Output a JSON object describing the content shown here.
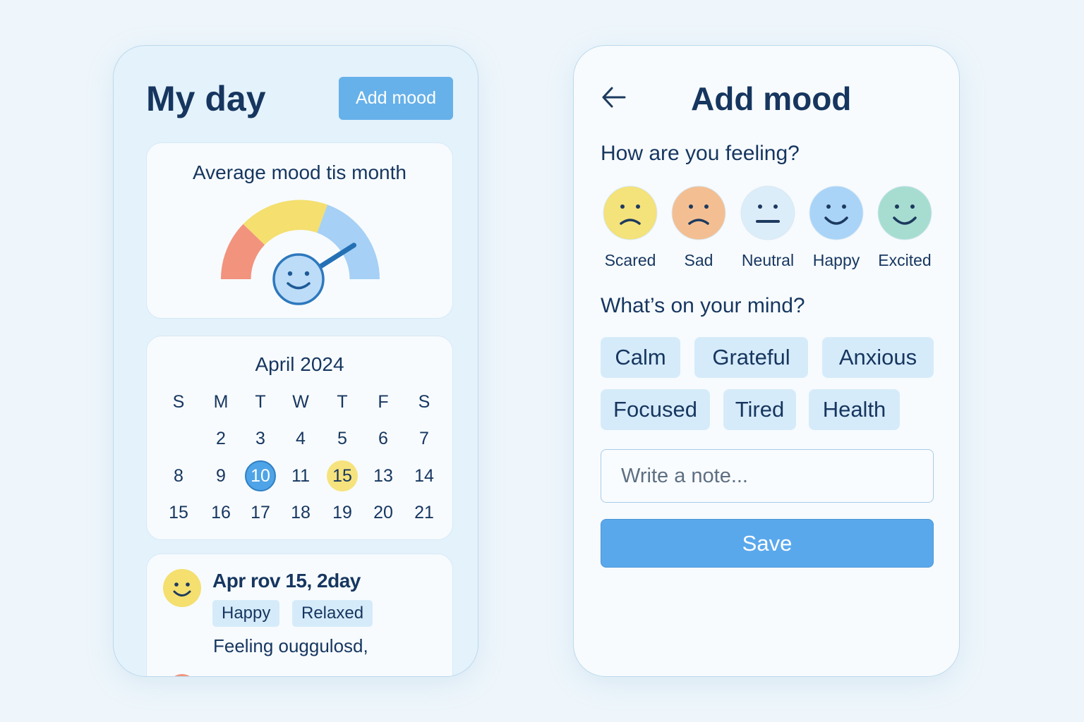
{
  "my_day": {
    "title": "My day",
    "add_mood_label": "Add mood",
    "average": {
      "title": "Average mood tis month",
      "gauge_level": 0.82,
      "gauge_colors": [
        "#f2937e",
        "#f4df6f",
        "#a6d0f5"
      ]
    },
    "calendar": {
      "month_label": "April 2024",
      "weekday_headers": [
        "S",
        "M",
        "T",
        "W",
        "T",
        "F",
        "S"
      ],
      "rows": [
        [
          "",
          "2",
          "3",
          "4",
          "5",
          "6",
          "7"
        ],
        [
          "8",
          "9",
          "10",
          "11",
          "15",
          "13",
          "14"
        ],
        [
          "15",
          "16",
          "17",
          "18",
          "19",
          "20",
          "21"
        ]
      ],
      "highlights": {
        "10": "blue",
        "15": "yellow"
      }
    },
    "entry": {
      "face_icon": "happy-face-icon",
      "date": "Apr rov 15, 2day",
      "tags": [
        "Happy",
        "Relaxed"
      ],
      "note": "Feeling ouggulosd,"
    }
  },
  "add_mood": {
    "back_icon": "arrow-left-icon",
    "title": "Add mood",
    "feeling_question": "How are you feeling?",
    "moods": [
      {
        "label": "Scared",
        "color": "#f4e27a",
        "mouth": "frown"
      },
      {
        "label": "Sad",
        "color": "#f3bf92",
        "mouth": "frown"
      },
      {
        "label": "Neutral",
        "color": "#dcedfa",
        "mouth": "flat"
      },
      {
        "label": "Happy",
        "color": "#a9d4f7",
        "mouth": "smile"
      },
      {
        "label": "Excited",
        "color": "#a7ddd1",
        "mouth": "smile"
      }
    ],
    "mind_question": "What’s on your mind?",
    "chips": [
      "Calm",
      "Grateful",
      "Anxious",
      "Focused",
      "Tired",
      "Health"
    ],
    "note_placeholder": "Write a note...",
    "save_label": "Save"
  }
}
